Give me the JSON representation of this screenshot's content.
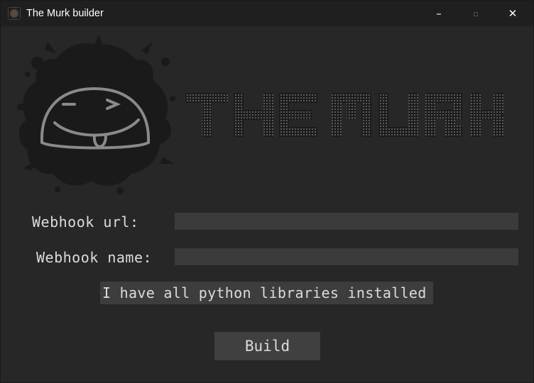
{
  "window": {
    "title": "The Murk builder",
    "icon": "murk-app-icon",
    "controls": {
      "minimize": "–",
      "maximize": "▫",
      "close": "✕"
    }
  },
  "logo": {
    "mascot": "murk-splat-face",
    "text": "THE MURK"
  },
  "form": {
    "webhook_url_label": "Webhook url:",
    "webhook_url_value": "",
    "webhook_name_label": "Webhook name:",
    "webhook_name_value": "",
    "libraries_checkbox_label": "I have all python libraries installed",
    "build_label": "Build"
  },
  "colors": {
    "background": "#272727",
    "titlebar": "#1f1f1f",
    "input": "#3b3b3b",
    "button": "#404040",
    "text": "#dcdcdc"
  }
}
